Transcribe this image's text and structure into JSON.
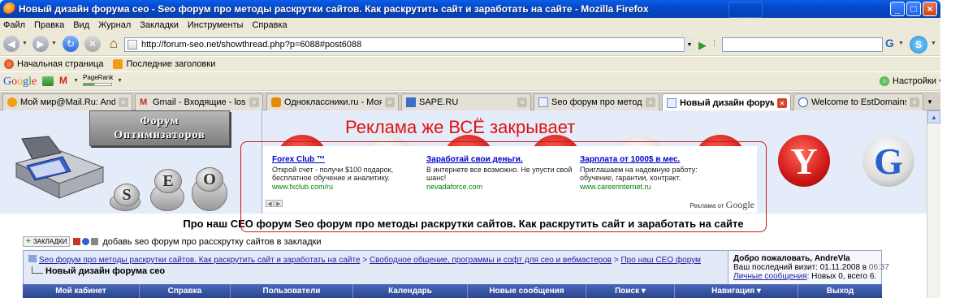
{
  "window": {
    "title": "Новый дизайн форума сео - Seo форум про методы раскрутки сайтов. Как раскрутить сайт и заработать на сайте - Mozilla Firefox",
    "min_label": "_",
    "max_label": "□",
    "close_label": "×"
  },
  "menu": [
    "Файл",
    "Правка",
    "Вид",
    "Журнал",
    "Закладки",
    "Инструменты",
    "Справка"
  ],
  "nav": {
    "url": "http://forum-seo.net/showthread.php?p=6088#post6088",
    "search_value": "",
    "search_engine_glyph": "G"
  },
  "bookmarks": [
    {
      "label": "Начальная страница",
      "icon": "firefox-icon"
    },
    {
      "label": "Последние заголовки",
      "icon": "rss-icon"
    }
  ],
  "google_toolbar": {
    "logo": [
      "G",
      "o",
      "o",
      "g",
      "l",
      "e"
    ],
    "pagerank_label": "PageRank",
    "settings_label": "Настройки"
  },
  "tabs": [
    {
      "label": "Мой мир@Mail.Ru: Andrew ...",
      "active": false
    },
    {
      "label": "Gmail - Входящие - losandr...",
      "active": false
    },
    {
      "label": "Одноклассники.ru - Моя с...",
      "active": false
    },
    {
      "label": "SAPE.RU",
      "active": false
    },
    {
      "label": "Seo форум про методы рас...",
      "active": false
    },
    {
      "label": "Новый дизайн форума с...",
      "active": true
    },
    {
      "label": "Welcome to EstDomains",
      "active": false
    }
  ],
  "page": {
    "logo_line1": "Форум",
    "logo_line2": "Оптимизаторов",
    "coin_letters": [
      "S",
      "E",
      "O"
    ],
    "annotation": "Реклама же ВСЁ закрывает",
    "circle_glyphs": {
      "red": "Y",
      "grey": "G"
    },
    "ads": [
      {
        "title": "Forex Club ™",
        "text": "Открой счет - получи $100 подарок, бесплатное обучение и аналитику.",
        "url": "www.fxclub.com/ru"
      },
      {
        "title": "Заработай свои деньги.",
        "text": "В интернете все возможно. Не упусти свой шанс!",
        "url": "nevadaforce.com"
      },
      {
        "title": "Зарплата от 1000$ в мес.",
        "text": "Приглашаем на надомную работу: обучение, гарантии, контракт.",
        "url": "www.careerinternet.ru"
      }
    ],
    "ads_by": "Реклама от",
    "ads_by_brand": "Google",
    "site_title": "Про наш СЕО форум Seo форум про методы раскрутки сайтов. Как раскрутить сайт и заработать на сайте",
    "bookmark_button": "ЗАКЛАДКИ",
    "bookmark_text": "добавь seo форум про расскрутку сайтов в закладки",
    "breadcrumbs": [
      "Seo форум про методы раскрутки сайтов. Как раскрутить сайт и заработать на сайте",
      "Свободное общение, программы и софт для сео и вебмастеров",
      "Про наш СЕО форум"
    ],
    "breadcrumb_sep": ">",
    "current_thread": "Новый дизайн форума сео",
    "welcome": {
      "greeting": "Добро пожаловать, AndreVla",
      "last_visit_label": "Ваш последний визит: 01.11.2008 в",
      "last_visit_time": "06:37",
      "pm_link": "Личные сообщения",
      "pm_text": ": Новых 0, всего 6."
    },
    "navstrip": [
      "Мой кабинет",
      "Справка",
      "Пользователи",
      "Календарь",
      "Новые сообщения",
      "Поиск ▾",
      "Навигация ▾",
      "Выход"
    ]
  }
}
